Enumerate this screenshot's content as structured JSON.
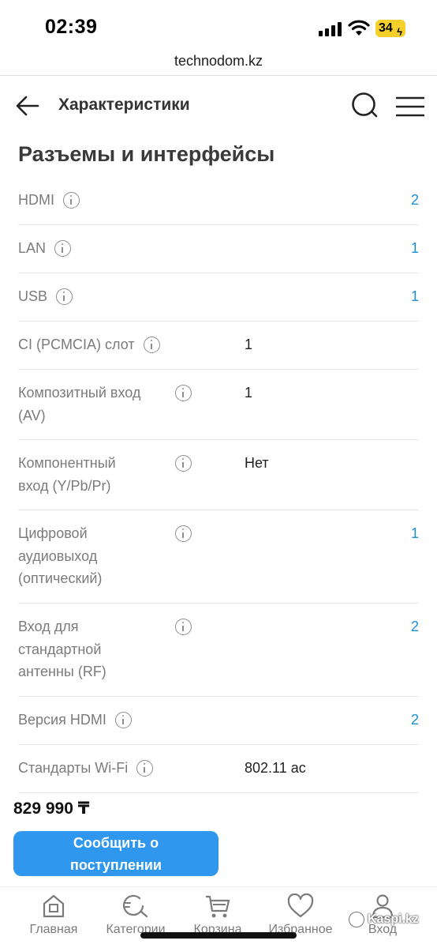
{
  "status_bar": {
    "time": "02:39",
    "battery": "34"
  },
  "browser": {
    "url": "technodom.kz"
  },
  "header": {
    "title": "Характеристики"
  },
  "section": {
    "title": "Разъемы и интерфейсы"
  },
  "specs": [
    {
      "label_lines": [
        "HDMI"
      ],
      "value": "2",
      "value_style": "link"
    },
    {
      "label_lines": [
        "LAN"
      ],
      "value": "1",
      "value_style": "link"
    },
    {
      "label_lines": [
        "USB"
      ],
      "value": "1",
      "value_style": "link"
    },
    {
      "label_lines": [
        "CI (PCMCIA) слот"
      ],
      "value": "1",
      "value_style": "plain"
    },
    {
      "label_lines": [
        "Композитный вход",
        "(AV)"
      ],
      "value": "1",
      "value_style": "plain"
    },
    {
      "label_lines": [
        "Компонентный",
        "вход (Y/Pb/Pr)"
      ],
      "value": "Нет",
      "value_style": "plain"
    },
    {
      "label_lines": [
        "Цифровой",
        "аудиовыход",
        "(оптический)"
      ],
      "value": "1",
      "value_style": "link"
    },
    {
      "label_lines": [
        "Вход для",
        "стандартной",
        "антенны (RF)"
      ],
      "value": "2",
      "value_style": "link"
    },
    {
      "label_lines": [
        "Версия HDMI"
      ],
      "value": "2",
      "value_style": "link"
    },
    {
      "label_lines": [
        "Стандарты Wi-Fi"
      ],
      "value": "802.11 ac",
      "value_style": "plain"
    }
  ],
  "product": {
    "price": "829 990 ₸",
    "notify_button_lines": [
      "Сообщить о",
      "поступлении"
    ]
  },
  "bottom_nav": {
    "items": [
      {
        "label": "Главная",
        "icon": "home-icon"
      },
      {
        "label": "Категории",
        "icon": "categories-search-icon"
      },
      {
        "label": "Корзина",
        "icon": "cart-icon"
      },
      {
        "label": "Избранное",
        "icon": "heart-icon"
      },
      {
        "label": "Вход",
        "icon": "user-icon"
      }
    ]
  },
  "watermark": {
    "text": "Kaspi.kz"
  },
  "colors": {
    "accent": "#2f97ee",
    "link_value": "#1a8fd6",
    "label_gray": "#7b7b7b",
    "battery": "#f5d02a"
  }
}
